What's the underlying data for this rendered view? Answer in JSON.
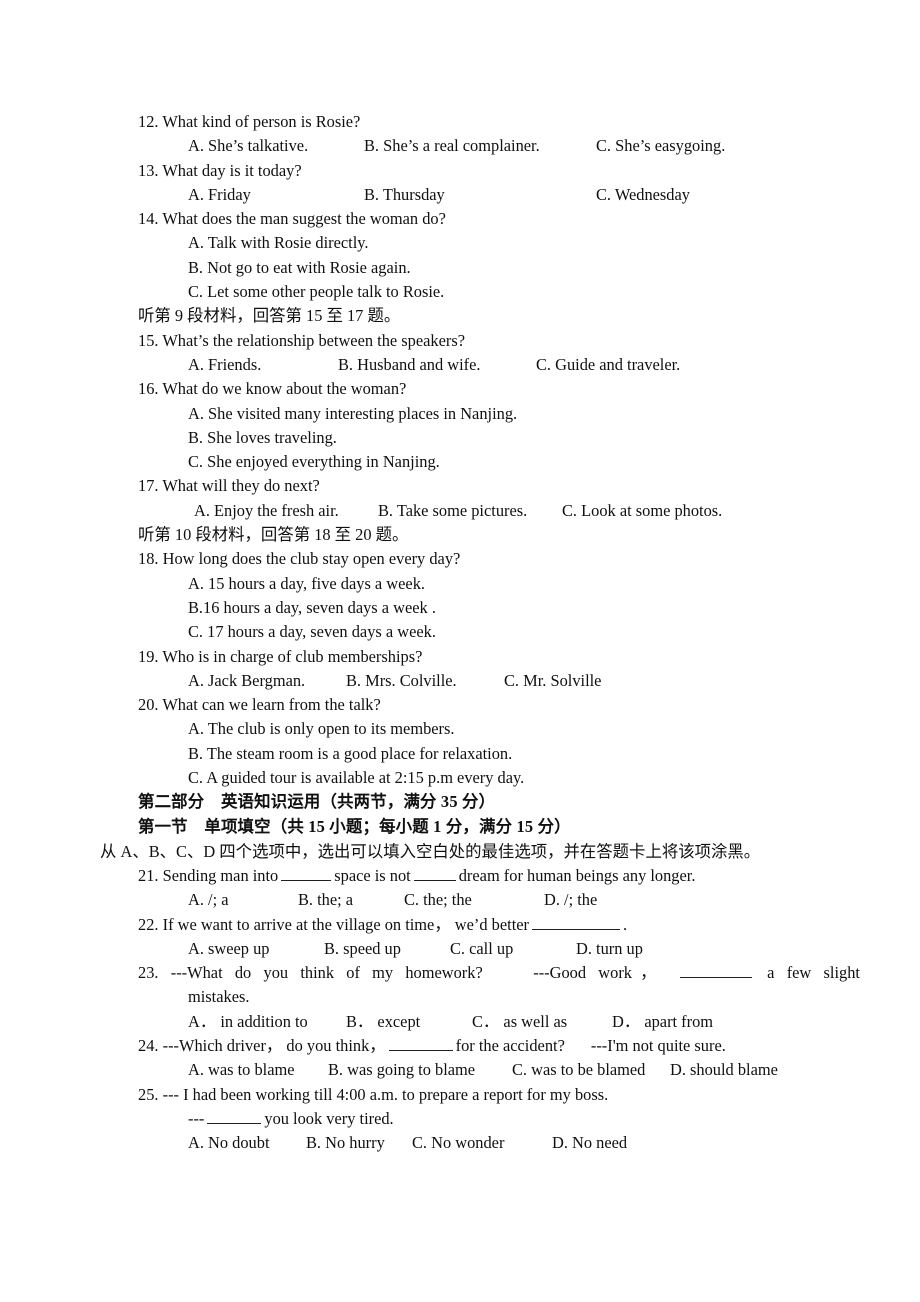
{
  "document": {
    "type": "exam-paper",
    "language": "zh-CN / en",
    "listening_section": {
      "questions": [
        {
          "number": "12.",
          "stem": "What kind of person is Rosie?",
          "options_inline": [
            "A. She’s talkative.",
            "B. She’s a real complainer.",
            "C. She’s easygoing."
          ]
        },
        {
          "number": "13.",
          "stem": "What day is it today?",
          "options_inline": [
            "A. Friday",
            "B. Thursday",
            "C. Wednesday"
          ]
        },
        {
          "number": "14.",
          "stem": "What does the man suggest the woman do?",
          "options_stacked": [
            "A. Talk with Rosie directly.",
            "B. Not go to eat with Rosie again.",
            "C. Let some other people talk to Rosie."
          ]
        }
      ],
      "material_9_instruction": "听第 9 段材料，回答第 15 至 17 题。",
      "questions_9": [
        {
          "number": "15.",
          "stem": "What’s the relationship between the speakers?",
          "options_inline": [
            "A. Friends.",
            "B. Husband and wife.",
            "C. Guide and traveler."
          ]
        },
        {
          "number": "16.",
          "stem": "What do we know about the woman?",
          "options_stacked": [
            "A. She visited many interesting places in Nanjing.",
            "B. She loves traveling.",
            "C. She enjoyed everything in Nanjing."
          ]
        },
        {
          "number": "17.",
          "stem": "What will they do next?",
          "options_inline": [
            "A. Enjoy the fresh air.",
            "B. Take some pictures.",
            "C. Look at some photos."
          ]
        }
      ],
      "material_10_instruction": "听第 10 段材料，回答第 18 至 20 题。",
      "questions_10": [
        {
          "number": "18.",
          "stem": "How long does the club stay open every day?",
          "options_stacked": [
            "A. 15 hours a day, five days a week.",
            "B.16 hours a day, seven days a week .",
            "C. 17 hours a day, seven days a week."
          ]
        },
        {
          "number": "19.",
          "stem": "Who is in charge of club memberships?",
          "options_inline": [
            "A. Jack Bergman.",
            "B. Mrs. Colville.",
            "C. Mr. Solville"
          ]
        },
        {
          "number": "20.",
          "stem": "What can we learn from the talk?",
          "options_stacked": [
            "A. The club is only open to its members.",
            "B. The steam room is a good place for relaxation.",
            "C. A guided tour is available at 2:15 p.m every day."
          ]
        }
      ]
    },
    "part_two": {
      "heading": "第二部分　英语知识运用（共两节，满分 35 分）",
      "section_one_heading": "第一节　单项填空（共 15 小题；每小题 1 分，满分 15 分）",
      "instruction": "从 A、B、C、D 四个选项中，选出可以填入空白处的最佳选项，并在答题卡上将该项涂黑。",
      "questions": [
        {
          "number": "21.",
          "stem_part1": "Sending man into",
          "stem_part2": "space is not",
          "stem_part3": "dream for human beings any longer.",
          "options": [
            "A. /; a",
            "B. the; a",
            "C. the; the",
            "D. /; the"
          ]
        },
        {
          "number": "22.",
          "stem_part1": "If we want to arrive at the village on time， we’d better",
          "stem_part2": ".",
          "options": [
            "A. sweep up",
            "B. speed up",
            "C. call up",
            "D. turn up"
          ]
        },
        {
          "number": "23.",
          "stem_part1": "---What do you think of my homework?",
          "stem_part2": "---Good work，",
          "stem_part3": "a few slight",
          "stem_cont": "mistakes.",
          "options": [
            "A． in addition to",
            "B． except",
            "C． as well as",
            "D． apart from"
          ]
        },
        {
          "number": "24.",
          "stem_part1": "---Which driver， do you think，",
          "stem_part2": "for the accident?",
          "stem_part3": "---I'm not quite sure.",
          "options": [
            "A. was to blame",
            "B. was going to blame",
            "C. was to be blamed",
            "D. should blame"
          ]
        },
        {
          "number": "25.",
          "stem_part1": "--- I had been working till 4:00 a.m. to prepare a report for my boss.",
          "stem_part2a": "---",
          "stem_part2b": "you look very tired.",
          "options": [
            "A. No doubt",
            "B. No hurry",
            "C. No wonder",
            "D. No need"
          ]
        }
      ]
    }
  }
}
